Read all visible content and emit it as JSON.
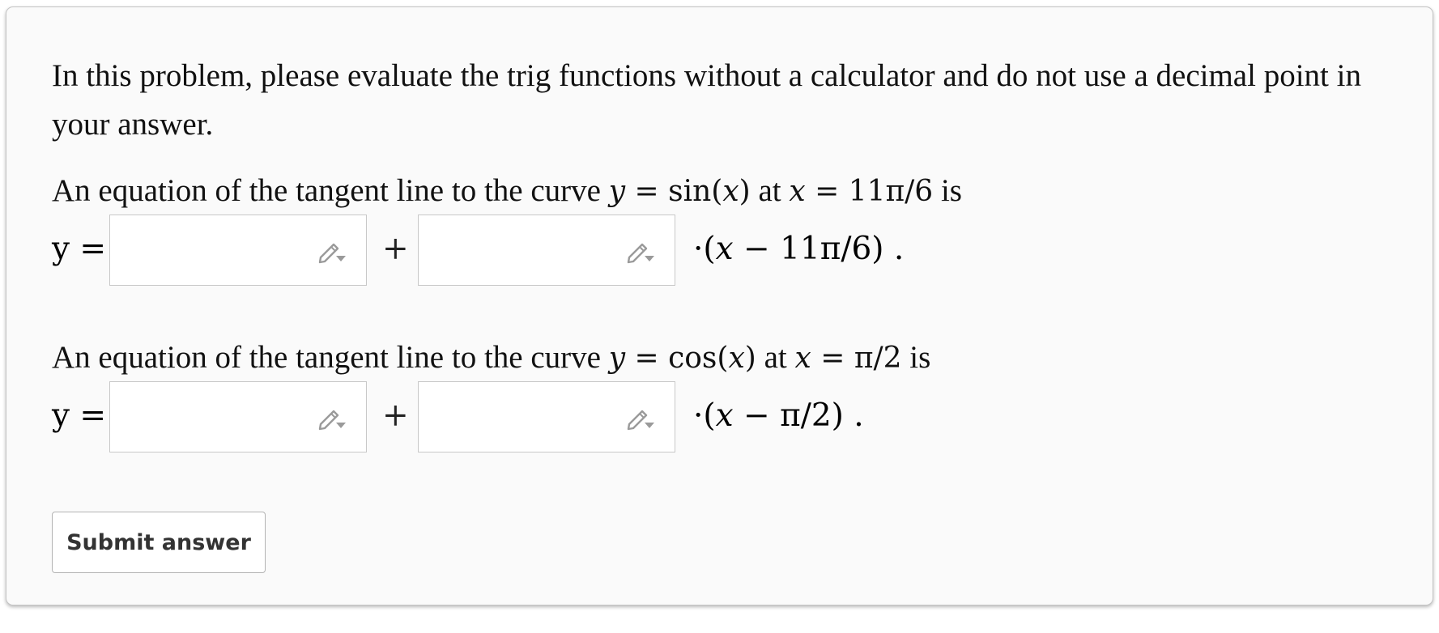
{
  "instructions": "In this problem, please evaluate the trig functions without a calculator and do not use a decimal point in your answer.",
  "questions": [
    {
      "text_before": "An equation of the tangent line to the curve ",
      "curve_y": "y",
      "curve_eq": " = sin(",
      "curve_x": "x",
      "curve_close": ")",
      "text_at": " at ",
      "at_x": "x",
      "at_value": " = 11π/6",
      "text_is": "  is",
      "answer_lhs": "y =",
      "plus": "+",
      "tail_prefix": "·(",
      "tail_x": "x",
      "tail_rest": " − 11π/6) .",
      "field_a_value": "",
      "field_b_value": ""
    },
    {
      "text_before": "An equation of the tangent line to the curve ",
      "curve_y": "y",
      "curve_eq": " = cos(",
      "curve_x": "x",
      "curve_close": ")",
      "text_at": " at ",
      "at_x": "x",
      "at_value": " = π/2",
      "text_is": "  is",
      "answer_lhs": "y =",
      "plus": "+",
      "tail_prefix": "·(",
      "tail_x": "x",
      "tail_rest": " − π/2) .",
      "field_a_value": "",
      "field_b_value": ""
    }
  ],
  "submit_label": "Submit answer",
  "icons": {
    "field_tool": "pencil-dropdown-icon"
  },
  "colors": {
    "card_background": "#fafafa",
    "card_border": "#c4c4c4",
    "field_border": "#c8c8c8",
    "icon_gray": "#9a9a9a",
    "text": "#111111"
  }
}
